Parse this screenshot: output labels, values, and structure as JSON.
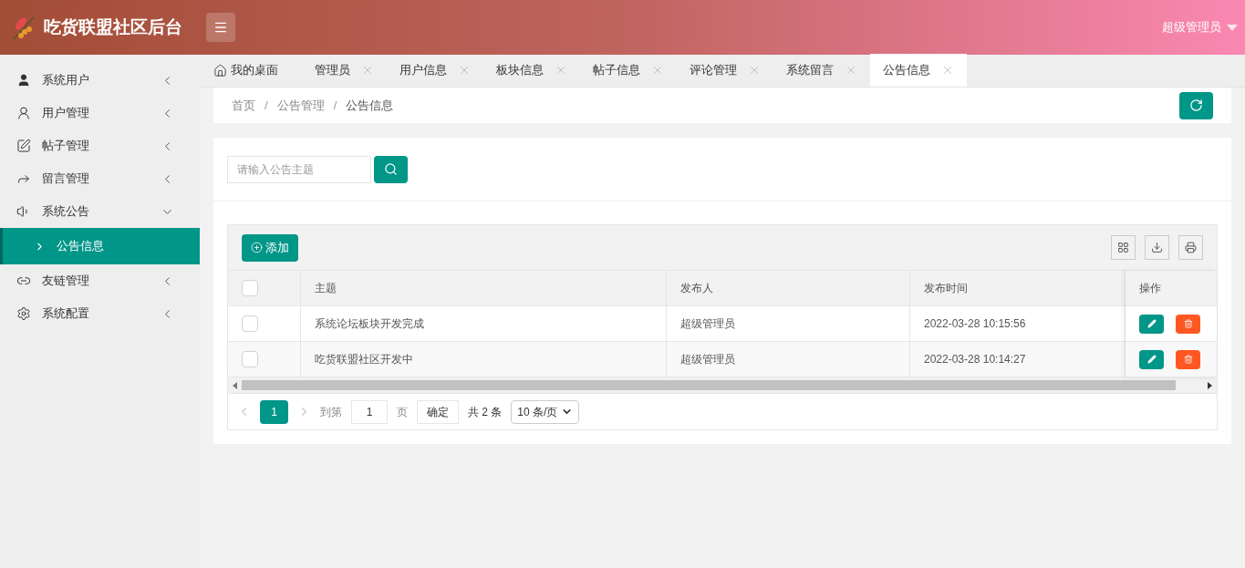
{
  "header": {
    "title": "吃货联盟社区后台",
    "user": "超级管理员"
  },
  "sidebar": {
    "items": [
      {
        "label": "系统用户",
        "expanded": false
      },
      {
        "label": "用户管理",
        "expanded": false
      },
      {
        "label": "帖子管理",
        "expanded": false
      },
      {
        "label": "留言管理",
        "expanded": false
      },
      {
        "label": "系统公告",
        "expanded": true,
        "children": [
          {
            "label": "公告信息",
            "selected": true
          }
        ]
      },
      {
        "label": "友链管理",
        "expanded": false
      },
      {
        "label": "系统配置",
        "expanded": false
      }
    ]
  },
  "tabs": [
    {
      "label": "我的桌面",
      "selected": false,
      "kind": "home"
    },
    {
      "label": "管理员",
      "selected": false,
      "kind": "closable"
    },
    {
      "label": "用户信息",
      "selected": false,
      "kind": "closable"
    },
    {
      "label": "板块信息",
      "selected": false,
      "kind": "closable"
    },
    {
      "label": "帖子信息",
      "selected": false,
      "kind": "closable"
    },
    {
      "label": "评论管理",
      "selected": false,
      "kind": "closable"
    },
    {
      "label": "系统留言",
      "selected": false,
      "kind": "closable"
    },
    {
      "label": "公告信息",
      "selected": true,
      "kind": "closable"
    }
  ],
  "breadcrumb": {
    "items": [
      "首页",
      "公告管理",
      "公告信息"
    ],
    "separators": [
      "/",
      "/"
    ]
  },
  "search": {
    "placeholder": "请输入公告主题"
  },
  "toolbar": {
    "add": "添加"
  },
  "table": {
    "all_checked": false,
    "columns": [
      "主题",
      "发布人",
      "发布时间",
      "操作"
    ],
    "rows": [
      {
        "checked": false,
        "cells": [
          "系统论坛板块开发完成",
          "超级管理员",
          "2022-03-28 10:15:56"
        ]
      },
      {
        "checked": false,
        "cells": [
          "吃货联盟社区开发中",
          "超级管理员",
          "2022-03-28 10:14:27"
        ]
      }
    ]
  },
  "pagination": {
    "pages": [
      {
        "label": "1",
        "selected": true
      }
    ],
    "goto": "到第",
    "page_value": "1",
    "page_unit": "页",
    "confirm": "确定",
    "total": "共 2 条",
    "page_size": "10 条/页"
  }
}
